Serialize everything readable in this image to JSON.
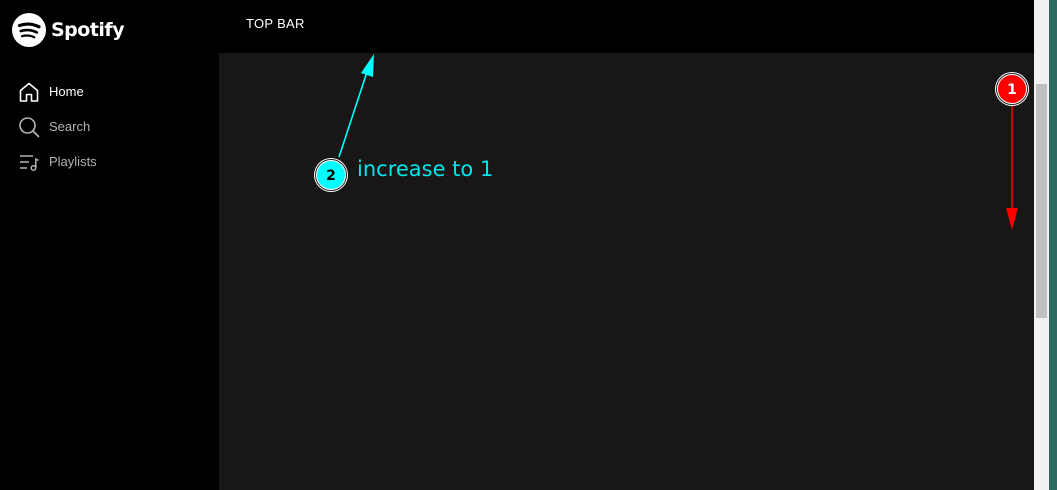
{
  "brand": {
    "name": "Spotify",
    "logo_icon": "spotify-logo-icon"
  },
  "sidebar": {
    "items": [
      {
        "label": "Home",
        "icon": "home-icon",
        "active": true
      },
      {
        "label": "Search",
        "icon": "search-icon",
        "active": false
      },
      {
        "label": "Playlists",
        "icon": "playlist-icon",
        "active": false
      }
    ]
  },
  "topbar": {
    "title": "TOP BAR"
  },
  "annotations": [
    {
      "number": "1",
      "color": "#ff0000"
    },
    {
      "number": "2",
      "color": "#00ffff",
      "text": "increase to 1"
    }
  ],
  "colors": {
    "sidebar_bg": "#000000",
    "main_bg": "#191616",
    "text_active": "#ffffff",
    "text_inactive": "#b3b3b3"
  }
}
